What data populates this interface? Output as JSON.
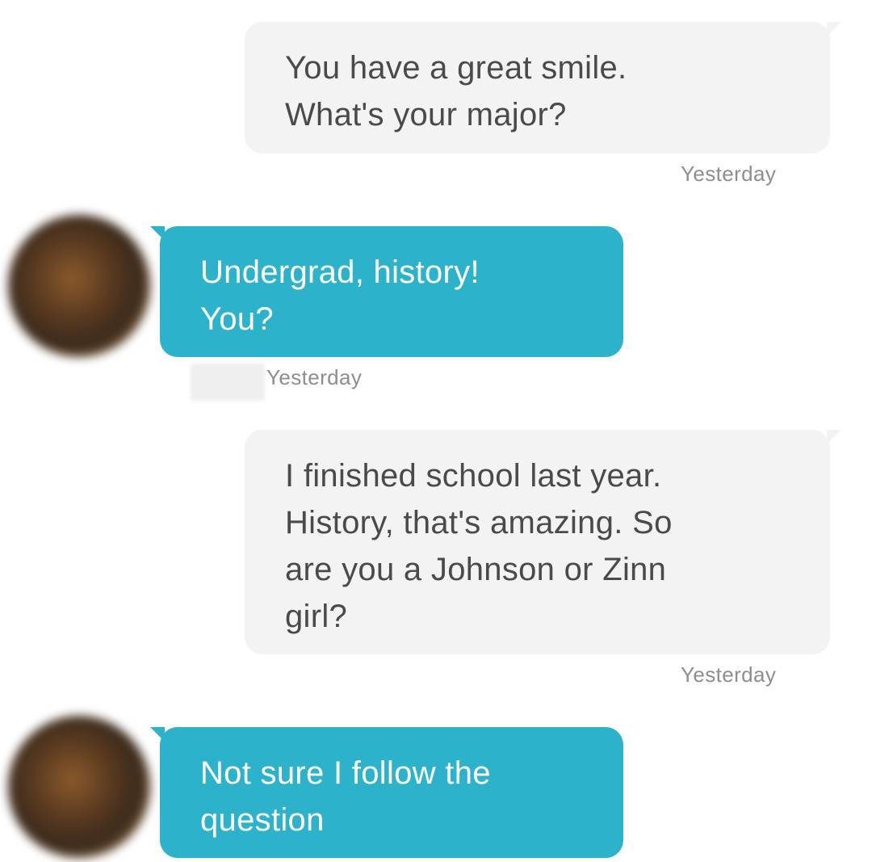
{
  "messages": [
    {
      "direction": "outgoing",
      "lines": [
        "You have a great smile.",
        "What's your major?"
      ],
      "timestamp": "Yesterday"
    },
    {
      "direction": "incoming",
      "lines": [
        "Undergrad, history!",
        "You?"
      ],
      "timestamp": "Yesterday"
    },
    {
      "direction": "outgoing",
      "lines": [
        "I finished school last year.",
        "History, that's amazing. So",
        "are you a Johnson or Zinn",
        "girl?"
      ],
      "timestamp": "Yesterday"
    },
    {
      "direction": "incoming",
      "lines": [
        "Not sure I follow the",
        "question"
      ]
    }
  ],
  "colors": {
    "incoming_bubble": "#2cb3cb",
    "outgoing_bubble": "#f3f3f3",
    "outgoing_text": "#4a4a4a",
    "timestamp_text": "#8e8e8e"
  }
}
